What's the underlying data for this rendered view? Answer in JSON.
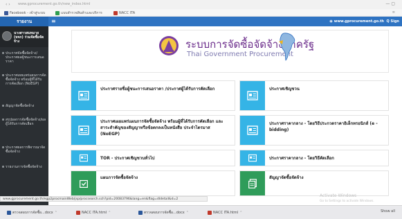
{
  "browser": {
    "url": "www.gprocurement.go.th/new_index.html",
    "window_controls": "—  ▢",
    "bookmarks": [
      {
        "label": "Facebook - เข้าสู่ระบบ",
        "color": "#3b5998"
      },
      {
        "label": "แบบสำรวจสินค้าและบริการ",
        "color": "#2e9d4f"
      },
      {
        "label": "NACC ITA",
        "color": "#c0392b"
      }
    ],
    "bookmarks_more": "≡"
  },
  "appbar": {
    "brand": "รายงาน",
    "menu_toggle": "≡",
    "site": "www.gprocurement.go.th",
    "signin": "Q Sign"
  },
  "sidebar": {
    "user_name": "นางสาวสมหมาย (หจก) ร่วมจัดซื้อจัดจ้าง",
    "items": [
      "ประกาศจัดซื้อจัดจ้าง/ประกาศผลผู้ชนะการเสนอราคา",
      "ประกาศเผยแพร่แผนการจัดซื้อจัดจ้าง พร้อมผู้ที่ได้รับการคัดเลือก (NoEGP)",
      "สัญญาจัดซื้อจัดจ้าง",
      "สรุปผลการจัดซื้อจัดจ้าง/ผลผู้ได้รับการคัดเลือก",
      "ประกาศผลการพิจารณาจัดซื้อจัดจ้าง",
      "รายงานการจัดซื้อจัดจ้าง"
    ]
  },
  "logo": {
    "title": "ระบบการจัดซื้อจัดจ้างภาครัฐ",
    "subtitle": "Thai Government Procurement"
  },
  "cards": [
    {
      "label": "ประกาศรายชื่อผู้ชนะการเสนอราคา /ประกาศผู้ได้รับการคัดเลือก",
      "icon": "document-icon"
    },
    {
      "label": "ประกาศเชิญชวน",
      "icon": "document-icon"
    },
    {
      "label": "ประกาศเผยแพร่แผนการจัดซื้อจัดจ้าง พร้อมผู้ที่ได้รับการคัดเลือก และสาระสำคัญของสัญญาหรือข้อตกลงเป็นหนังสือ ประจำไตรมาส (NoEGP)",
      "icon": "document-icon"
    },
    {
      "label": "ประกาศราคากลาง - โดยวิธีประกวดราคาอิเล็กทรอนิกส์ (e - bidding)",
      "icon": "document-icon"
    },
    {
      "label": "TOR - ประกาศเชิญชวนทั่วไป",
      "icon": "document-icon"
    },
    {
      "label": "ประกาศราคากลาง - โดยวิธีคัดเลือก",
      "icon": "document-icon"
    },
    {
      "label": "แผนการจัดซื้อจัดจ้าง",
      "icon": "plan-icon"
    },
    {
      "label": "สัญญาจัดซื้อจัดจ้าง",
      "icon": "contract-icon"
    }
  ],
  "statusbar": "www.gprocurement.go.th/egp2procmainWeb/jsp/procsearch.sch?pid=20083796&lang=en&flag=dldetail&d=2",
  "watermark": {
    "title": "Activate Windows",
    "subtitle": "Go to Settings to activate Windows."
  },
  "taskbar": {
    "items": [
      {
        "label": "ตรวจสอบการจัดซื้อ...docx",
        "color": "#2b579a"
      },
      {
        "label": "NACC ITA.html",
        "color": "#c0392b"
      },
      {
        "label": "ตรวจสอบการจัดซื้อ...docx",
        "color": "#2b579a"
      },
      {
        "label": "NACC ITA.html",
        "color": "#c0392b"
      }
    ],
    "show_all": "Show all"
  }
}
